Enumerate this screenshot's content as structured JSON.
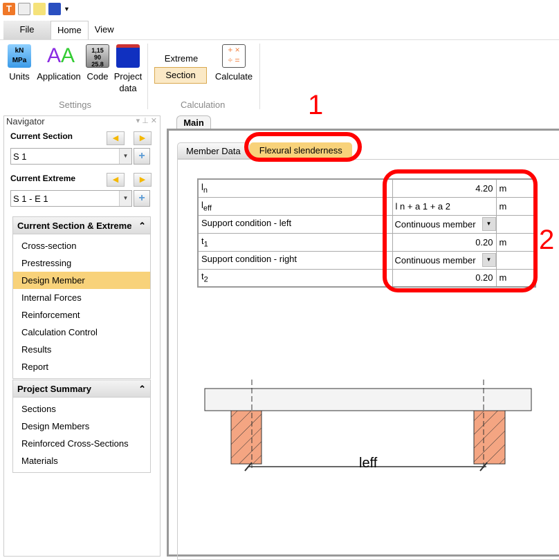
{
  "ribbon": {
    "tabs": [
      "File",
      "Home",
      "View"
    ],
    "buttons": {
      "units": "Units",
      "application": "Application",
      "code": "Code",
      "project_data": "Project data",
      "extreme": "Extreme",
      "section": "Section",
      "calculate": "Calculate"
    },
    "groups": {
      "settings": "Settings",
      "calculation": "Calculation"
    }
  },
  "navigator": {
    "title": "Navigator",
    "current_section_label": "Current Section",
    "current_section_value": "S 1",
    "current_extreme_label": "Current Extreme",
    "current_extreme_value": "S 1 - E 1",
    "section1_title": "Current Section & Extreme",
    "section1_items": [
      "Cross-section",
      "Prestressing",
      "Design Member",
      "Internal Forces",
      "Reinforcement",
      "Calculation Control",
      "Results",
      "Report"
    ],
    "section2_title": "Project Summary",
    "section2_items": [
      "Sections",
      "Design Members",
      "Reinforced Cross-Sections",
      "Materials"
    ]
  },
  "main": {
    "tab": "Main",
    "subtabs": [
      "Member Data",
      "Flexural slenderness"
    ],
    "rows": [
      {
        "label": "l",
        "sub": "n",
        "value": "4.20",
        "unit": "m"
      },
      {
        "label": "l",
        "sub": "eff",
        "value": "l n + a 1 + a 2",
        "unit": "m"
      },
      {
        "label": "Support condition - left",
        "sub": "",
        "value": "Continuous member",
        "unit": ""
      },
      {
        "label": "t",
        "sub": "1",
        "value": "0.20",
        "unit": "m"
      },
      {
        "label": "Support condition - right",
        "sub": "",
        "value": "Continuous member",
        "unit": ""
      },
      {
        "label": "t",
        "sub": "2",
        "value": "0.20",
        "unit": "m"
      }
    ],
    "diagram_label": "leff"
  },
  "annotations": [
    "1",
    "2"
  ]
}
